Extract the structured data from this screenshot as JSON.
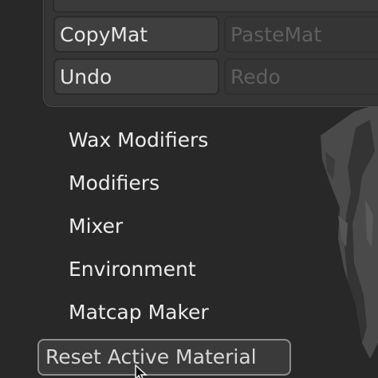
{
  "material_panel": {
    "buttons": [
      {
        "label": "CopyMat",
        "enabled": true
      },
      {
        "label": "PasteMat",
        "enabled": false
      },
      {
        "label": "Undo",
        "enabled": true
      },
      {
        "label": "Redo",
        "enabled": false
      }
    ]
  },
  "menu": {
    "items": [
      {
        "label": "Wax Modifiers"
      },
      {
        "label": "Modifiers"
      },
      {
        "label": "Mixer"
      },
      {
        "label": "Environment"
      },
      {
        "label": "Matcap Maker"
      }
    ]
  },
  "reset_button": {
    "label": "Reset Active Material"
  },
  "colors": {
    "background": "#282828",
    "panel": "#353535",
    "text": "#ececec",
    "disabled_text": "#5f5f5f",
    "reset_border": "#8c8c8c"
  },
  "icons": [
    "cursor-arrow-icon"
  ]
}
